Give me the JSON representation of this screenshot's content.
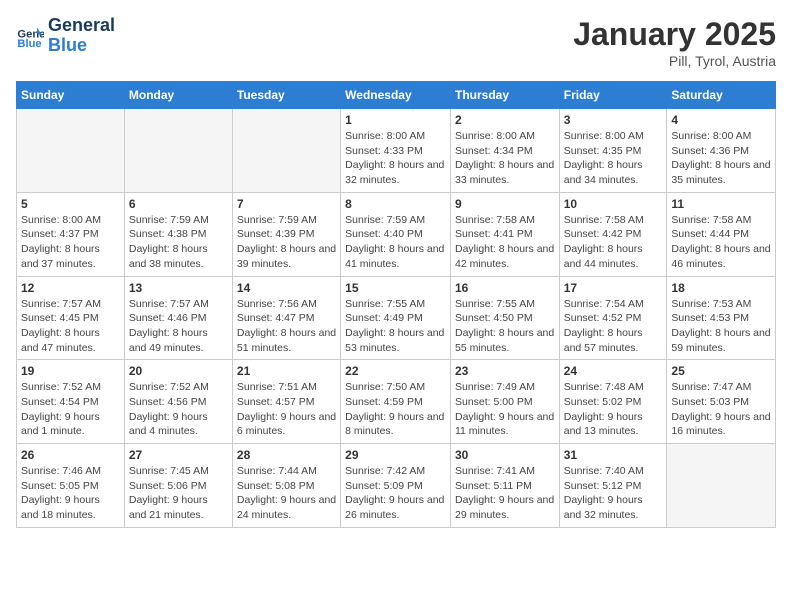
{
  "header": {
    "logo_line1": "General",
    "logo_line2": "Blue",
    "month": "January 2025",
    "location": "Pill, Tyrol, Austria"
  },
  "weekdays": [
    "Sunday",
    "Monday",
    "Tuesday",
    "Wednesday",
    "Thursday",
    "Friday",
    "Saturday"
  ],
  "weeks": [
    [
      {
        "day": "",
        "info": ""
      },
      {
        "day": "",
        "info": ""
      },
      {
        "day": "",
        "info": ""
      },
      {
        "day": "1",
        "info": "Sunrise: 8:00 AM\nSunset: 4:33 PM\nDaylight: 8 hours\nand 32 minutes."
      },
      {
        "day": "2",
        "info": "Sunrise: 8:00 AM\nSunset: 4:34 PM\nDaylight: 8 hours\nand 33 minutes."
      },
      {
        "day": "3",
        "info": "Sunrise: 8:00 AM\nSunset: 4:35 PM\nDaylight: 8 hours\nand 34 minutes."
      },
      {
        "day": "4",
        "info": "Sunrise: 8:00 AM\nSunset: 4:36 PM\nDaylight: 8 hours\nand 35 minutes."
      }
    ],
    [
      {
        "day": "5",
        "info": "Sunrise: 8:00 AM\nSunset: 4:37 PM\nDaylight: 8 hours\nand 37 minutes."
      },
      {
        "day": "6",
        "info": "Sunrise: 7:59 AM\nSunset: 4:38 PM\nDaylight: 8 hours\nand 38 minutes."
      },
      {
        "day": "7",
        "info": "Sunrise: 7:59 AM\nSunset: 4:39 PM\nDaylight: 8 hours\nand 39 minutes."
      },
      {
        "day": "8",
        "info": "Sunrise: 7:59 AM\nSunset: 4:40 PM\nDaylight: 8 hours\nand 41 minutes."
      },
      {
        "day": "9",
        "info": "Sunrise: 7:58 AM\nSunset: 4:41 PM\nDaylight: 8 hours\nand 42 minutes."
      },
      {
        "day": "10",
        "info": "Sunrise: 7:58 AM\nSunset: 4:42 PM\nDaylight: 8 hours\nand 44 minutes."
      },
      {
        "day": "11",
        "info": "Sunrise: 7:58 AM\nSunset: 4:44 PM\nDaylight: 8 hours\nand 46 minutes."
      }
    ],
    [
      {
        "day": "12",
        "info": "Sunrise: 7:57 AM\nSunset: 4:45 PM\nDaylight: 8 hours\nand 47 minutes."
      },
      {
        "day": "13",
        "info": "Sunrise: 7:57 AM\nSunset: 4:46 PM\nDaylight: 8 hours\nand 49 minutes."
      },
      {
        "day": "14",
        "info": "Sunrise: 7:56 AM\nSunset: 4:47 PM\nDaylight: 8 hours\nand 51 minutes."
      },
      {
        "day": "15",
        "info": "Sunrise: 7:55 AM\nSunset: 4:49 PM\nDaylight: 8 hours\nand 53 minutes."
      },
      {
        "day": "16",
        "info": "Sunrise: 7:55 AM\nSunset: 4:50 PM\nDaylight: 8 hours\nand 55 minutes."
      },
      {
        "day": "17",
        "info": "Sunrise: 7:54 AM\nSunset: 4:52 PM\nDaylight: 8 hours\nand 57 minutes."
      },
      {
        "day": "18",
        "info": "Sunrise: 7:53 AM\nSunset: 4:53 PM\nDaylight: 8 hours\nand 59 minutes."
      }
    ],
    [
      {
        "day": "19",
        "info": "Sunrise: 7:52 AM\nSunset: 4:54 PM\nDaylight: 9 hours\nand 1 minute."
      },
      {
        "day": "20",
        "info": "Sunrise: 7:52 AM\nSunset: 4:56 PM\nDaylight: 9 hours\nand 4 minutes."
      },
      {
        "day": "21",
        "info": "Sunrise: 7:51 AM\nSunset: 4:57 PM\nDaylight: 9 hours\nand 6 minutes."
      },
      {
        "day": "22",
        "info": "Sunrise: 7:50 AM\nSunset: 4:59 PM\nDaylight: 9 hours\nand 8 minutes."
      },
      {
        "day": "23",
        "info": "Sunrise: 7:49 AM\nSunset: 5:00 PM\nDaylight: 9 hours\nand 11 minutes."
      },
      {
        "day": "24",
        "info": "Sunrise: 7:48 AM\nSunset: 5:02 PM\nDaylight: 9 hours\nand 13 minutes."
      },
      {
        "day": "25",
        "info": "Sunrise: 7:47 AM\nSunset: 5:03 PM\nDaylight: 9 hours\nand 16 minutes."
      }
    ],
    [
      {
        "day": "26",
        "info": "Sunrise: 7:46 AM\nSunset: 5:05 PM\nDaylight: 9 hours\nand 18 minutes."
      },
      {
        "day": "27",
        "info": "Sunrise: 7:45 AM\nSunset: 5:06 PM\nDaylight: 9 hours\nand 21 minutes."
      },
      {
        "day": "28",
        "info": "Sunrise: 7:44 AM\nSunset: 5:08 PM\nDaylight: 9 hours\nand 24 minutes."
      },
      {
        "day": "29",
        "info": "Sunrise: 7:42 AM\nSunset: 5:09 PM\nDaylight: 9 hours\nand 26 minutes."
      },
      {
        "day": "30",
        "info": "Sunrise: 7:41 AM\nSunset: 5:11 PM\nDaylight: 9 hours\nand 29 minutes."
      },
      {
        "day": "31",
        "info": "Sunrise: 7:40 AM\nSunset: 5:12 PM\nDaylight: 9 hours\nand 32 minutes."
      },
      {
        "day": "",
        "info": ""
      }
    ]
  ]
}
